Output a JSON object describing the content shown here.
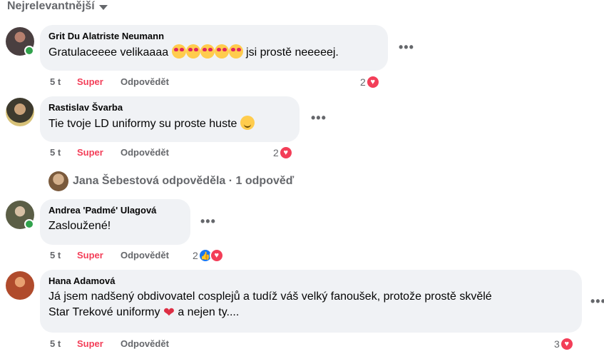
{
  "sort": {
    "label": "Nejrelevantnější"
  },
  "comments": [
    {
      "author": "Grit Du Alatriste Neumann",
      "text_before": "Gratulaceeee velikaaaa",
      "text_after": "jsi prostě neeeeej.",
      "time": "5 t",
      "reaction_label": "Super",
      "reply_label": "Odpovědět",
      "reaction_count": "2",
      "online": true
    },
    {
      "author": "Rastislav Švarba",
      "text_before": "Tie tvoje LD uniformy su proste huste",
      "text_after": "",
      "time": "5 t",
      "reaction_label": "Super",
      "reply_label": "Odpovědět",
      "reaction_count": "2",
      "online": false
    },
    {
      "author": "Andrea 'Padmé' Ulagová",
      "text_before": "Zasloužené!",
      "text_after": "",
      "time": "5 t",
      "reaction_label": "Super",
      "reply_label": "Odpovědět",
      "reaction_count": "2",
      "online": true
    },
    {
      "author": "Hana Adamová",
      "text_line1": "Já jsem nadšený obdivovatel cosplejů a tudíž váš velký fanoušek, protože prostě skvělé",
      "text_line2_before": "Star Trekové uniformy",
      "text_line2_after": "a nejen ty....",
      "time": "5 t",
      "reaction_label": "Super",
      "reply_label": "Odpovědět",
      "reaction_count": "3",
      "online": false
    }
  ],
  "replies_summary": {
    "text": "Jana Šebestová odpověděla · 1 odpověď"
  },
  "colors": {
    "super": "#f33e58",
    "bubble": "#f0f2f5",
    "muted": "#65676b",
    "online": "#31a24c",
    "like": "#1877f2"
  },
  "icons": [
    "caret-down-icon",
    "in-love-emoji-icon",
    "smile-emoji-icon",
    "heart-emoji-icon",
    "heart-reaction-icon",
    "like-reaction-icon",
    "more-options-icon"
  ]
}
